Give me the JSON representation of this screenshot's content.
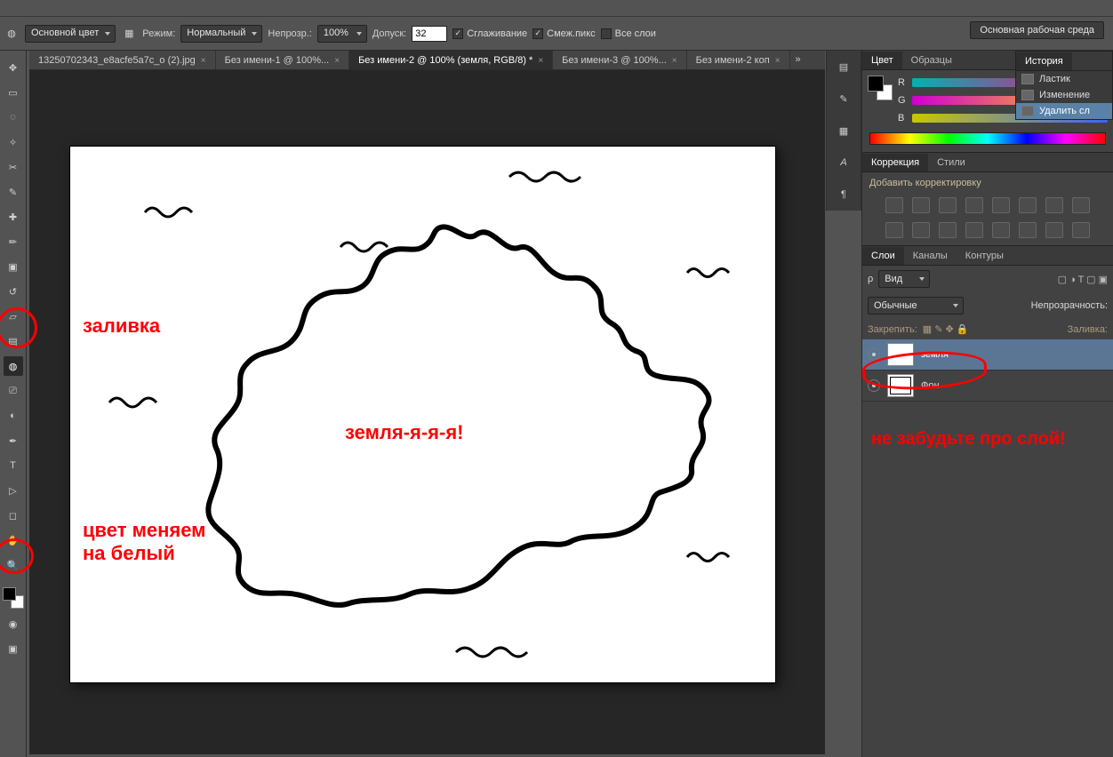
{
  "optbar": {
    "color_mode": "Основной цвет",
    "mode_label": "Режим:",
    "mode_value": "Нормальный",
    "opacity_label": "Непрозр.:",
    "opacity_value": "100%",
    "tolerance_label": "Допуск:",
    "tolerance_value": "32",
    "antialias": "Сглаживание",
    "contiguous": "Смеж.пикс",
    "all_layers": "Все слои",
    "workspace_btn": "Основная рабочая среда"
  },
  "tabs": [
    {
      "label": "13250702343_e8acfe5a7c_o (2).jpg",
      "active": false,
      "dirty": false
    },
    {
      "label": "Без имени-1 @ 100%...",
      "active": false,
      "dirty": true
    },
    {
      "label": "Без имени-2 @ 100% (земля, RGB/8) *",
      "active": true,
      "dirty": false
    },
    {
      "label": "Без имени-3 @ 100%...",
      "active": false,
      "dirty": true
    },
    {
      "label": "Без имени-2 коп",
      "active": false,
      "dirty": false
    }
  ],
  "tools": [
    {
      "name": "move-tool-icon",
      "g": "✥"
    },
    {
      "name": "marquee-tool-icon",
      "g": "▭"
    },
    {
      "name": "lasso-tool-icon",
      "g": "◌"
    },
    {
      "name": "magic-wand-tool-icon",
      "g": "✧"
    },
    {
      "name": "crop-tool-icon",
      "g": "✂"
    },
    {
      "name": "eyedropper-tool-icon",
      "g": "✎"
    },
    {
      "name": "healing-brush-tool-icon",
      "g": "✚"
    },
    {
      "name": "brush-tool-icon",
      "g": "✏"
    },
    {
      "name": "stamp-tool-icon",
      "g": "▣"
    },
    {
      "name": "history-brush-tool-icon",
      "g": "↺"
    },
    {
      "name": "eraser-tool-icon",
      "g": "▱"
    },
    {
      "name": "gradient-tool-icon",
      "g": "▤"
    },
    {
      "name": "paint-bucket-tool-icon",
      "g": "◍",
      "sel": true
    },
    {
      "name": "blur-tool-icon",
      "g": "⎚"
    },
    {
      "name": "dodge-tool-icon",
      "g": "◐"
    },
    {
      "name": "pen-tool-icon",
      "g": "✒"
    },
    {
      "name": "type-tool-icon",
      "g": "T"
    },
    {
      "name": "path-select-tool-icon",
      "g": "▷"
    },
    {
      "name": "shape-tool-icon",
      "g": "◻"
    },
    {
      "name": "hand-tool-icon",
      "g": "✋"
    },
    {
      "name": "zoom-tool-icon",
      "g": "🔍"
    }
  ],
  "panels": {
    "color_tab": "Цвет",
    "swatches_tab": "Образцы",
    "history_tab": "История",
    "channels": {
      "r": "R",
      "g": "G",
      "b": "B"
    },
    "adjustments_tab": "Коррекция",
    "styles_tab": "Стили",
    "add_adjustment": "Добавить корректировку",
    "layers_tab": "Слои",
    "channels_tab": "Каналы",
    "paths_tab": "Контуры",
    "filter_kind": "Вид",
    "blend_mode": "Обычные",
    "opacity_label": "Непрозрачность:",
    "lock_label": "Закрепить:",
    "fill_label": "Заливка:"
  },
  "history_items": [
    {
      "label": "Ластик",
      "sel": false
    },
    {
      "label": "Изменение",
      "sel": false
    },
    {
      "label": "Удалить сл",
      "sel": true
    }
  ],
  "layers": [
    {
      "name": "земля",
      "sel": true
    },
    {
      "name": "Фон",
      "sel": false
    }
  ],
  "annotations": {
    "fill": "заливка",
    "color_swap": "цвет меняем\nна белый",
    "land": "земля-я-я-я!",
    "layer_reminder": "не забудьте про слой!"
  }
}
